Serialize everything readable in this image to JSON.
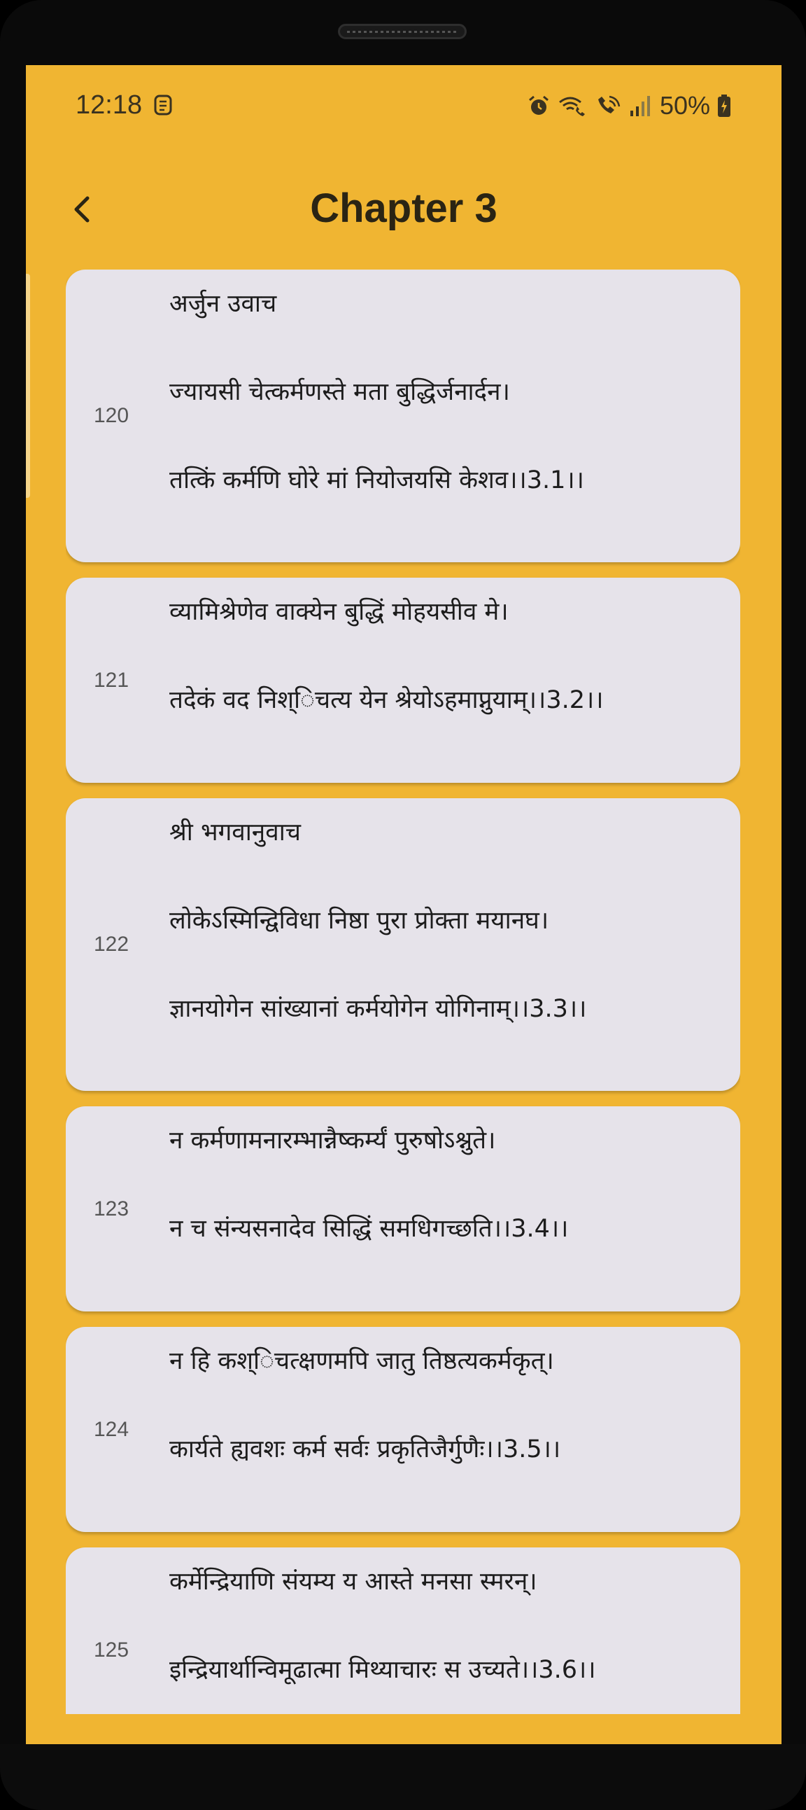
{
  "status_bar": {
    "time": "12:18",
    "battery": "50%",
    "icons": [
      "alarm-icon",
      "wifi-call-icon",
      "volte-call-icon",
      "signal-icon",
      "battery-charging-icon"
    ]
  },
  "app_bar": {
    "title": "Chapter 3",
    "back_icon": "chevron-left-icon"
  },
  "colors": {
    "background": "#F0B532",
    "card": "#E6E3EA",
    "text": "#1c1c1c",
    "number": "#555555"
  },
  "verses": [
    {
      "number": "120",
      "lines": [
        "अर्जुन उवाच",
        "ज्यायसी चेत्कर्मणस्ते मता बुद्धिर्जनार्दन।",
        "तत्किं कर्मणि घोरे मां नियोजयसि केशव।।3.1।।"
      ]
    },
    {
      "number": "121",
      "lines": [
        "व्यामिश्रेणेव वाक्येन बुद्धिं मोहयसीव मे।",
        "तदेकं वद निश्िचत्य येन श्रेयोऽहमाप्नुयाम्।।3.2।।"
      ]
    },
    {
      "number": "122",
      "lines": [
        "श्री भगवानुवाच",
        "लोकेऽस्मिन्द्विविधा निष्ठा पुरा प्रोक्ता मयानघ।",
        "ज्ञानयोगेन सांख्यानां कर्मयोगेन योगिनाम्।।3.3।।"
      ]
    },
    {
      "number": "123",
      "lines": [
        "न कर्मणामनारम्भान्नैष्कर्म्यं पुरुषोऽश्नुते।",
        "न च संन्यसनादेव सिद्धिं समधिगच्छति।।3.4।।"
      ]
    },
    {
      "number": "124",
      "lines": [
        "न हि कश्िचत्क्षणमपि जातु तिष्ठत्यकर्मकृत्।",
        "कार्यते ह्यवशः कर्म सर्वः प्रकृतिजैर्गुणैः।।3.5।।"
      ]
    },
    {
      "number": "125",
      "lines": [
        "कर्मेन्द्रियाणि संयम्य य आस्ते मनसा स्मरन्।",
        "इन्द्रियार्थान्विमूढात्मा मिथ्याचारः स उच्यते।।3.6।।"
      ]
    }
  ]
}
